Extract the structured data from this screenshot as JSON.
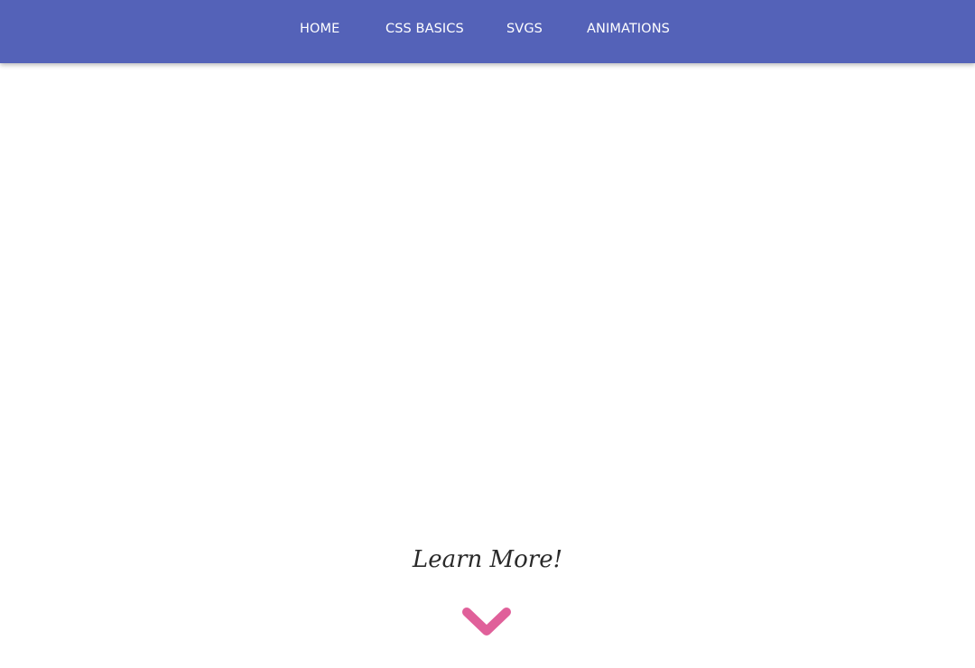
{
  "nav": {
    "items": [
      {
        "label": "HOME"
      },
      {
        "label": "CSS BASICS"
      },
      {
        "label": "SVGS"
      },
      {
        "label": "ANIMATIONS"
      }
    ]
  },
  "hero": {
    "cta_label": "Learn More!",
    "cta_icon": "chevron-down-icon"
  },
  "colors": {
    "nav_bg": "#5462b8",
    "nav_text": "#ffffff",
    "accent": "#e0609a",
    "cta_text": "#2a2a2a",
    "page_bg": "#ffffff"
  }
}
